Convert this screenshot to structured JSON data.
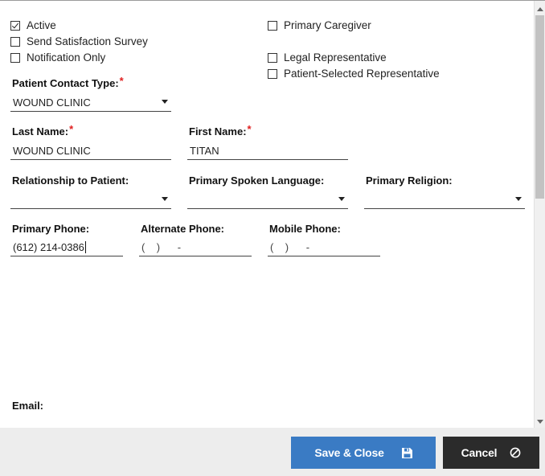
{
  "checkboxes": {
    "active": {
      "label": "Active",
      "checked": true
    },
    "send_survey": {
      "label": "Send Satisfaction Survey",
      "checked": false
    },
    "notification_only": {
      "label": "Notification Only",
      "checked": false
    },
    "primary_caregiver": {
      "label": "Primary Caregiver",
      "checked": false
    },
    "legal_rep": {
      "label": "Legal Representative",
      "checked": false
    },
    "patient_selected_rep": {
      "label": "Patient-Selected Representative",
      "checked": false
    }
  },
  "contact_type": {
    "label": "Patient Contact Type:",
    "required": "*",
    "value": "WOUND CLINIC"
  },
  "last_name": {
    "label": "Last Name:",
    "required": "*",
    "value": "WOUND CLINIC"
  },
  "first_name": {
    "label": "First Name:",
    "required": "*",
    "value": "TITAN"
  },
  "relationship": {
    "label": "Relationship to Patient:",
    "value": ""
  },
  "language": {
    "label": "Primary Spoken Language:",
    "value": ""
  },
  "religion": {
    "label": "Primary Religion:",
    "value": ""
  },
  "primary_phone": {
    "label": "Primary Phone:",
    "value": "(612) 214-0386"
  },
  "alternate_phone": {
    "label": "Alternate Phone:",
    "value": "(    )      -"
  },
  "mobile_phone": {
    "label": "Mobile Phone:",
    "value": "(    )      -"
  },
  "email": {
    "label": "Email:"
  },
  "footer": {
    "save_label": "Save & Close",
    "cancel_label": "Cancel"
  },
  "colors": {
    "save_button": "#3a7bc4",
    "cancel_button": "#2b2b2b",
    "required_marker": "#e02020"
  },
  "icons": {
    "save": "floppy-disk-icon",
    "cancel": "cancel-circle-icon"
  }
}
